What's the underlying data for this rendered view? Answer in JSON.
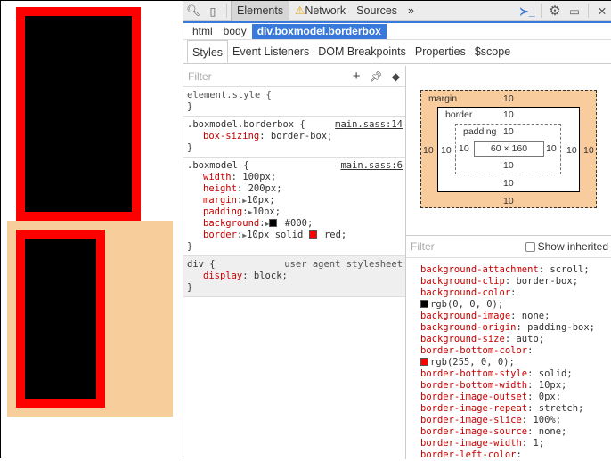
{
  "toolbar": {
    "tabs": [
      "Elements",
      "Network",
      "Sources"
    ],
    "more": "»",
    "warning": "⚠"
  },
  "breadcrumb": [
    "html",
    "body",
    "div.boxmodel.borderbox"
  ],
  "subtabs": [
    "Styles",
    "Event Listeners",
    "DOM Breakpoints",
    "Properties",
    "$scope"
  ],
  "styles": {
    "filter_placeholder": "Filter",
    "element_style": "element.style {",
    "close": "}",
    "rules": [
      {
        "selector": ".boxmodel.borderbox {",
        "source": "main.sass:14",
        "props": [
          {
            "name": "box-sizing",
            "value": " border-box;"
          }
        ]
      },
      {
        "selector": ".boxmodel {",
        "source": "main.sass:6",
        "props": [
          {
            "name": "width",
            "value": " 100px;"
          },
          {
            "name": "height",
            "value": " 200px;"
          },
          {
            "name": "margin",
            "value": "10px;",
            "expand": true
          },
          {
            "name": "padding",
            "value": "10px;",
            "expand": true
          },
          {
            "name": "background",
            "value": " #000;",
            "expand": true,
            "swatch": "#000000"
          },
          {
            "name": "border",
            "value": "10px solid ",
            "expand": true,
            "swatch": "#ff0000",
            "after": " red;"
          }
        ]
      },
      {
        "selector": "div {",
        "source": "user agent stylesheet",
        "props": [
          {
            "name": "display",
            "value": " block;"
          }
        ]
      }
    ]
  },
  "boxmodel": {
    "margin_label": "margin",
    "border_label": "border",
    "padding_label": "padding",
    "margin": "10",
    "border": "10",
    "padding": "10",
    "content": "60 × 160"
  },
  "computed": {
    "filter_placeholder": "Filter",
    "show_inherited": "Show inherited",
    "props": [
      {
        "name": "background-attachment",
        "value": " scroll;"
      },
      {
        "name": "background-clip",
        "value": " border-box;"
      },
      {
        "name": "background-color",
        "value": ""
      },
      {
        "name": "",
        "value": "rgb(0, 0, 0);",
        "swatch": "#000000"
      },
      {
        "name": "background-image",
        "value": " none;"
      },
      {
        "name": "background-origin",
        "value": " padding-box;"
      },
      {
        "name": "background-size",
        "value": " auto;"
      },
      {
        "name": "border-bottom-color",
        "value": ""
      },
      {
        "name": "",
        "value": "rgb(255, 0, 0);",
        "swatch": "#ff0000"
      },
      {
        "name": "border-bottom-style",
        "value": " solid;"
      },
      {
        "name": "border-bottom-width",
        "value": " 10px;"
      },
      {
        "name": "border-image-outset",
        "value": " 0px;"
      },
      {
        "name": "border-image-repeat",
        "value": " stretch;"
      },
      {
        "name": "border-image-slice",
        "value": " 100%;"
      },
      {
        "name": "border-image-source",
        "value": " none;"
      },
      {
        "name": "border-image-width",
        "value": " 1;"
      },
      {
        "name": "border-left-color",
        "value": ""
      }
    ]
  }
}
